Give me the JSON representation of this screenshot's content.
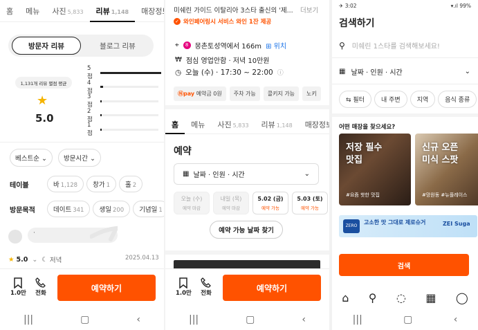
{
  "p1": {
    "tabs": [
      {
        "label": "홈",
        "count": ""
      },
      {
        "label": "메뉴",
        "count": ""
      },
      {
        "label": "사진",
        "count": "5,833"
      },
      {
        "label": "리뷰",
        "count": "1,148"
      },
      {
        "label": "매장정보",
        "count": ""
      }
    ],
    "toggle": {
      "visitor": "방문자 리뷰",
      "blog": "블로그 리뷰"
    },
    "avg_tooltip": "1,131개 리뷰 별점 평균",
    "avg_score": "5.0",
    "distribution": [
      {
        "label": "5점",
        "count": "1058",
        "fraction": 1.0
      },
      {
        "label": "4점",
        "count": "58",
        "fraction": 0.05
      },
      {
        "label": "3점",
        "count": "12",
        "fraction": 0.01
      },
      {
        "label": "2점",
        "count": "2",
        "fraction": 0.002
      },
      {
        "label": "1점",
        "count": "1",
        "fraction": 0.001
      }
    ],
    "sort": {
      "best": "베스트순",
      "visit_time": "방문시간"
    },
    "table_label": "테이블",
    "table_chips": [
      {
        "label": "바",
        "count": "1,128"
      },
      {
        "label": "창가",
        "count": "1"
      },
      {
        "label": "홀",
        "count": "2"
      }
    ],
    "purpose_label": "방문목적",
    "purpose_chips": [
      {
        "label": "데이트",
        "count": "341"
      },
      {
        "label": "생일",
        "count": "200"
      },
      {
        "label": "기념일",
        "count": "1"
      }
    ],
    "reviewer_dot": "·",
    "review_score": "5.0",
    "review_time": "저녁",
    "review_date": "2025.04.13",
    "bottom": {
      "save_count": "1.0만",
      "call_label": "전화",
      "reserve_label": "예약하기"
    }
  },
  "p2": {
    "headline": "미쉐린 가이드 이탈리아 3스타 출신의 '제...",
    "more_label": "더보기",
    "wine_notice": "와인페어링시 서비스 와인 1잔 제공",
    "location_text": "몽촌토성역에서 166m",
    "location_link": "위치",
    "hours_text": "점심 영업안함 · 저녁 10만원",
    "today_text": "오늘 (수) · 17:30 ~ 22:00",
    "feature_chips": [
      "예약금 0원",
      "주차 가능",
      "콜키지 가능",
      "노키"
    ],
    "pay_badge": "pay",
    "tabs": [
      {
        "label": "홈",
        "count": ""
      },
      {
        "label": "메뉴",
        "count": ""
      },
      {
        "label": "사진",
        "count": "5,833"
      },
      {
        "label": "리뷰",
        "count": "1,148"
      },
      {
        "label": "매장정보",
        "count": ""
      }
    ],
    "reserve_title": "예약",
    "date_selector": "날짜 · 인원 · 시간",
    "dates": [
      {
        "label": "오늘 (수)",
        "status": "예약 마감",
        "available": false
      },
      {
        "label": "내일 (목)",
        "status": "예약 마감",
        "available": false
      },
      {
        "label": "5.02 (금)",
        "status": "예약 가능",
        "available": true
      },
      {
        "label": "5.03 (토)",
        "status": "예약 가능",
        "available": true
      }
    ],
    "find_button": "예약 가능 날짜 찾기",
    "bottom": {
      "save_count": "1.0만",
      "call_label": "전화",
      "reserve_label": "예약하기"
    }
  },
  "p3": {
    "status_time": "3:02",
    "battery": "99%",
    "title": "검색하기",
    "search_placeholder": "미쉐린 1스타를 검색해보세요!",
    "date_selector": "날짜 · 인원 · 시간",
    "filters": [
      "필터",
      "내 주변",
      "지역",
      "음식 종류"
    ],
    "section_title": "어떤 매장을 찾으세요?",
    "cards": [
      {
        "title": "저장 필수\n맛집",
        "tag": "#요즘 핫한 맛집"
      },
      {
        "title": "신규 오픈\n미식 스팟",
        "tag": "#망원동 #뉴플레이스"
      }
    ],
    "ad": {
      "brand": "ZERO",
      "headline": "고소한 맛 그대로 제로슈거",
      "sub": "ZEI Suga"
    },
    "search_button": "검색"
  },
  "colors": {
    "accent": "#ff5200",
    "star": "#f5b400"
  }
}
